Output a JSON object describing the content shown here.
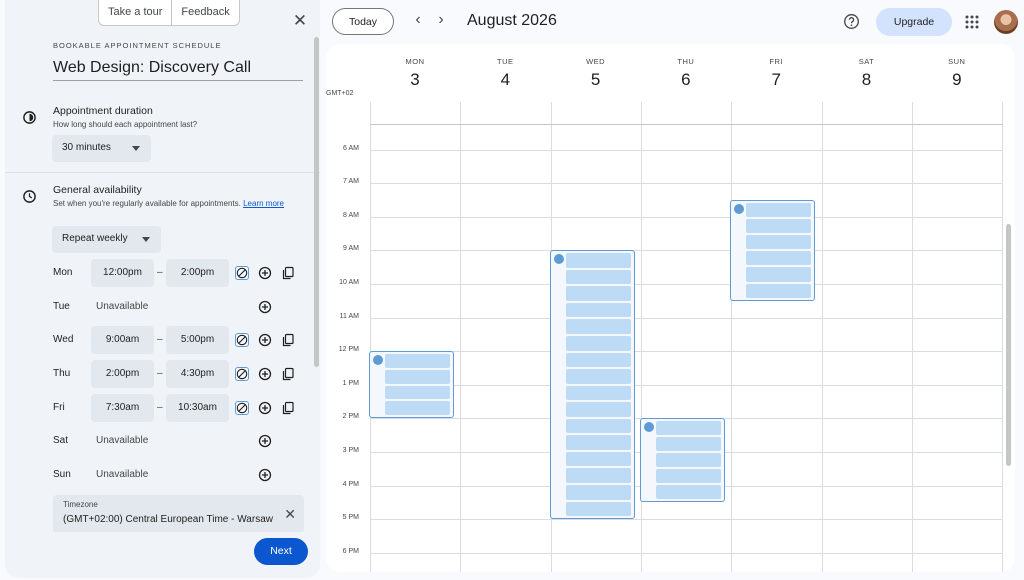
{
  "panel": {
    "take_tour": "Take a tour",
    "feedback": "Feedback",
    "close": "✕",
    "eyebrow": "BOOKABLE APPOINTMENT SCHEDULE",
    "title": "Web Design: Discovery Call",
    "duration": {
      "title": "Appointment duration",
      "subtitle": "How long should each appointment last?",
      "value": "30 minutes"
    },
    "availability": {
      "title": "General availability",
      "subtitle": "Set when you're regularly available for appointments.",
      "learn_more": "Learn more",
      "repeat": "Repeat weekly"
    },
    "days": [
      {
        "day": "Mon",
        "start": "12:00pm",
        "end": "2:00pm"
      },
      {
        "day": "Tue",
        "unavailable": "Unavailable"
      },
      {
        "day": "Wed",
        "start": "9:00am",
        "end": "5:00pm"
      },
      {
        "day": "Thu",
        "start": "2:00pm",
        "end": "4:30pm"
      },
      {
        "day": "Fri",
        "start": "7:30am",
        "end": "10:30am"
      },
      {
        "day": "Sat",
        "unavailable": "Unavailable"
      },
      {
        "day": "Sun",
        "unavailable": "Unavailable"
      }
    ],
    "dash": "–",
    "timezone": {
      "label": "Timezone",
      "value": "(GMT+02:00) Central European Time - Warsaw"
    },
    "next": "Next"
  },
  "header": {
    "today": "Today",
    "month": "August 2026",
    "upgrade": "Upgrade"
  },
  "calendar": {
    "timezone": "GMT+02",
    "days": [
      {
        "dow": "MON",
        "num": "3"
      },
      {
        "dow": "TUE",
        "num": "4"
      },
      {
        "dow": "WED",
        "num": "5"
      },
      {
        "dow": "THU",
        "num": "6"
      },
      {
        "dow": "FRI",
        "num": "7"
      },
      {
        "dow": "SAT",
        "num": "8"
      },
      {
        "dow": "SUN",
        "num": "9"
      }
    ],
    "hours": [
      "6 AM",
      "7 AM",
      "8 AM",
      "9 AM",
      "10 AM",
      "11 AM",
      "12 PM",
      "1 PM",
      "2 PM",
      "3 PM",
      "4 PM",
      "5 PM",
      "6 PM"
    ],
    "availability_blocks": [
      {
        "day_index": 0,
        "start": "12:00",
        "end": "14:00",
        "slots": 4
      },
      {
        "day_index": 2,
        "start": "09:00",
        "end": "17:00",
        "slots": 16
      },
      {
        "day_index": 3,
        "start": "14:00",
        "end": "16:30",
        "slots": 5
      },
      {
        "day_index": 4,
        "start": "07:30",
        "end": "10:30",
        "slots": 6
      }
    ]
  },
  "colors": {
    "accent": "#0b57d0",
    "upgrade_bg": "#d3e3fd",
    "slot_fill": "#bddbf4",
    "slot_border": "#5e9bd6"
  }
}
